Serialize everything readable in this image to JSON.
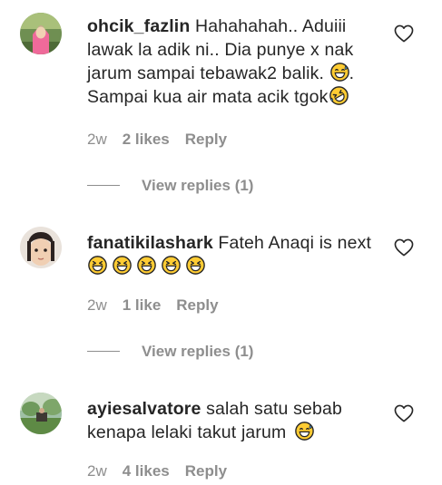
{
  "comments": [
    {
      "avatar_icon": "user-avatar-girl-hijab-icon",
      "username": "ohcik_fazlin",
      "text": "Hahahahah.. Aduiii lawak la adik ni.. Dia punye x nak jarum sampai tebawak2 balik.",
      "text_after_first_emoji": ". Sampai kua air mata acik tgok",
      "emojis": [
        "grinning-sweat-face-emoji",
        "rolling-on-floor-laughing-emoji"
      ],
      "time": "2w",
      "likes": "2 likes",
      "reply_label": "Reply",
      "view_replies": "View replies (1)"
    },
    {
      "avatar_icon": "user-avatar-child-icon",
      "username": "fanatikilashark",
      "text": "Fateh Anaqi is next",
      "emojis": [
        "grinning-squinting-face-emoji",
        "grinning-squinting-face-emoji",
        "grinning-squinting-face-emoji",
        "grinning-squinting-face-emoji",
        "grinning-squinting-face-emoji"
      ],
      "time": "2w",
      "likes": "1 like",
      "reply_label": "Reply",
      "view_replies": "View replies (1)"
    },
    {
      "avatar_icon": "user-avatar-outdoor-icon",
      "username": "ayiesalvatore",
      "text": "salah satu sebab kenapa lelaki takut jarum",
      "emojis": [
        "grinning-sweat-face-emoji"
      ],
      "time": "2w",
      "likes": "4 likes",
      "reply_label": "Reply"
    }
  ],
  "colors": {
    "text": "#262626",
    "secondary": "#8e8e8e",
    "emoji_yellow": "#ffcc33"
  }
}
